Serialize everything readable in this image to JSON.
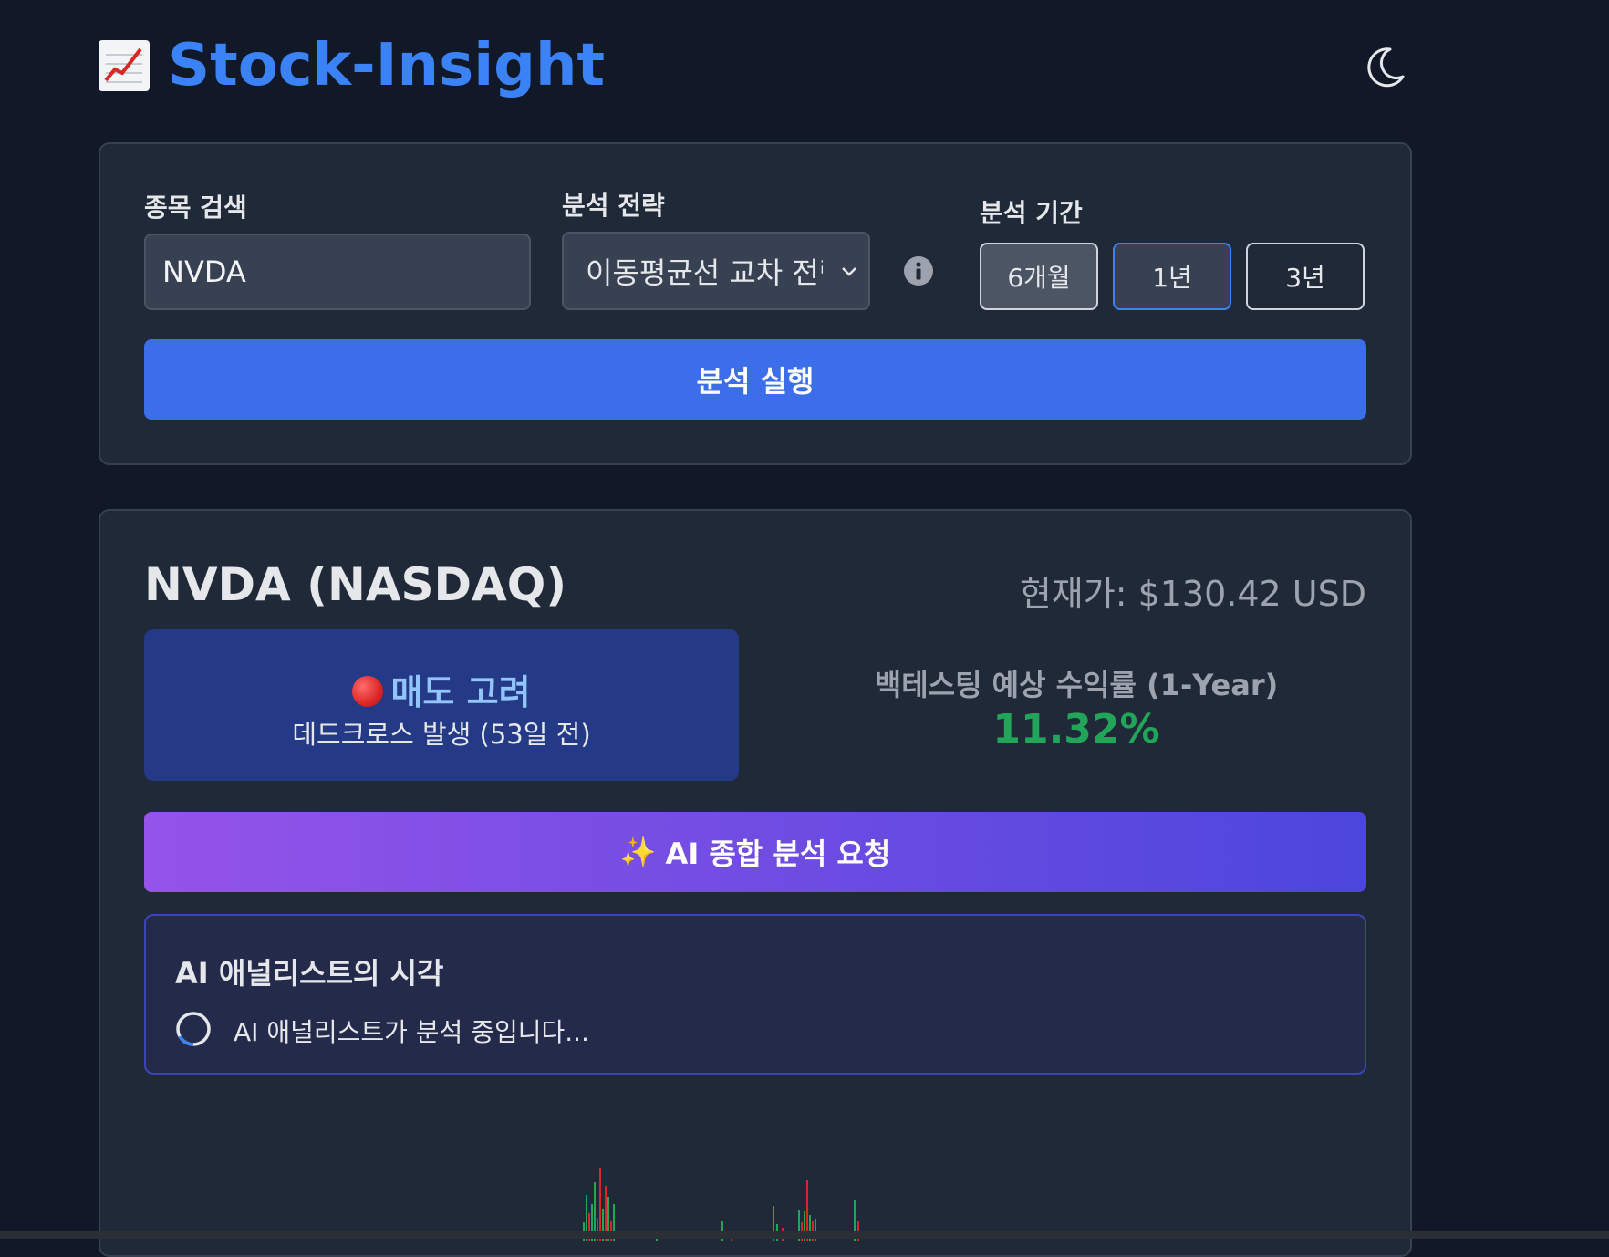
{
  "header": {
    "icon": "chart-increasing-icon",
    "title": "Stock-Insight",
    "theme_icon": "moon-icon"
  },
  "search": {
    "ticker_label": "종목 검색",
    "ticker_value": "NVDA",
    "strategy_label": "분석 전략",
    "strategy_value": "이동평균선 교차 전략",
    "period_label": "분석 기간",
    "periods": [
      "6개월",
      "1년",
      "3년"
    ],
    "run_label": "분석 실행"
  },
  "result": {
    "ticker_title": "NVDA (NASDAQ)",
    "price": "현재가: $130.42 USD",
    "signal": {
      "label": "매도 고려",
      "detail": "데드크로스 발생 (53일 전)",
      "color": "#dc2626"
    },
    "backtest_label": "백테스팅 예상 수익률 (1-Year)",
    "backtest_value": "11.32%",
    "ai_button": "AI 종합 분석 요청",
    "ai_panel_title": "AI 애널리스트의 시각",
    "ai_status": "AI 애널리스트가 분석 중입니다..."
  },
  "colors": {
    "accent": "#3b82f6",
    "positive": "#22a559",
    "negative": "#dc2626",
    "background": "#111827"
  }
}
